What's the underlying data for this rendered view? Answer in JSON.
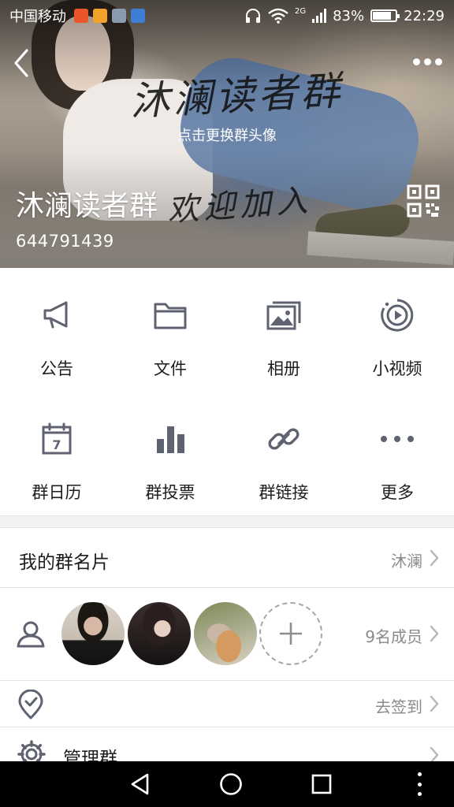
{
  "status_bar": {
    "carrier": "中国移动",
    "network": "2G",
    "battery": "83%",
    "battery_level": 0.83,
    "time": "22:29",
    "notification_colors": [
      "#e8562a",
      "#f0a22a",
      "#8a9bb0",
      "#3d7fd6"
    ]
  },
  "header": {
    "back_icon": "chevron-left-icon",
    "more_icon": "more-horizontal-icon",
    "cover_calligraphy_title": "沐澜读者群",
    "cover_calligraphy_welcome": "欢迎加入",
    "change_avatar_hint": "点击更换群头像",
    "group_name": "沐澜读者群",
    "group_id": "644791439",
    "qr_icon": "qr-code-icon"
  },
  "features": [
    {
      "label": "公告",
      "icon": "megaphone-icon"
    },
    {
      "label": "文件",
      "icon": "folder-icon"
    },
    {
      "label": "相册",
      "icon": "photo-album-icon"
    },
    {
      "label": "小视频",
      "icon": "video-play-icon"
    },
    {
      "label": "群日历",
      "icon": "calendar-icon",
      "calendar_day": "7"
    },
    {
      "label": "群投票",
      "icon": "bar-chart-icon"
    },
    {
      "label": "群链接",
      "icon": "link-icon"
    },
    {
      "label": "更多",
      "icon": "more-horizontal-icon"
    }
  ],
  "my_card": {
    "title": "我的群名片",
    "value": "沐澜"
  },
  "members": {
    "count_label": "9名成员",
    "icon": "members-icon",
    "add_icon": "plus-icon"
  },
  "checkin": {
    "icon": "location-check-icon",
    "value": "去签到"
  },
  "manage": {
    "icon": "gear-icon",
    "title": "管理群"
  },
  "colors": {
    "icon_gray": "#5f6270",
    "divider": "#e2e2e5",
    "section_bg": "#f2f2f4",
    "secondary_text": "#8a8a8e"
  }
}
